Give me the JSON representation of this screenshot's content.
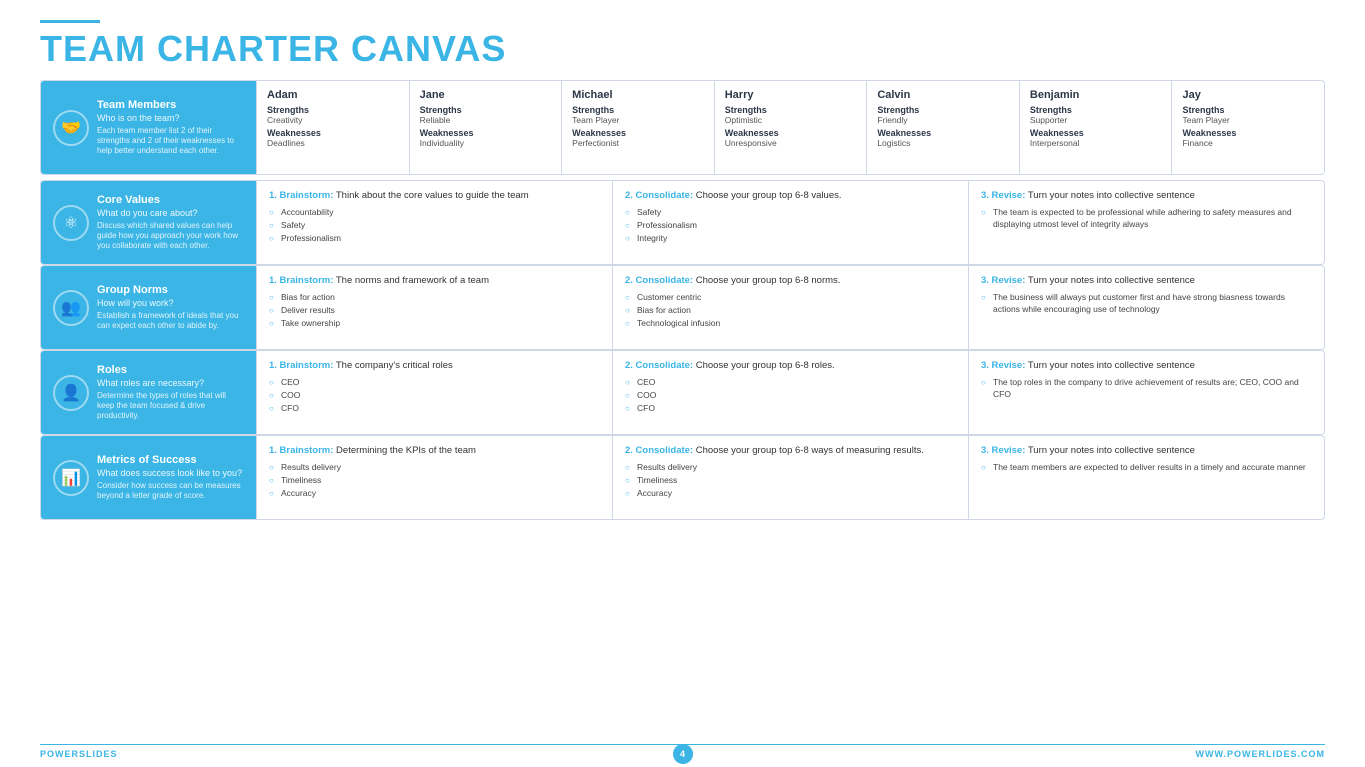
{
  "title": {
    "accent": "",
    "part1": "TEAM CHARTER ",
    "part2": "CANVAS"
  },
  "teamMembers": {
    "label": {
      "title": "Team Members",
      "subtitle": "Who is on the team?",
      "desc": "Each team member list 2 of their strengths and 2 of their weaknesses to help better understand each other."
    },
    "members": [
      {
        "name": "Adam",
        "strengthsLabel": "Strengths",
        "strengthsValue": "Creativity",
        "weaknessesLabel": "Weaknesses",
        "weaknessesValue": "Deadlines"
      },
      {
        "name": "Jane",
        "strengthsLabel": "Strengths",
        "strengthsValue": "Reliable",
        "weaknessesLabel": "Weaknesses",
        "weaknessesValue": "Individuality"
      },
      {
        "name": "Michael",
        "strengthsLabel": "Strengths",
        "strengthsValue": "Team Player",
        "weaknessesLabel": "Weaknesses",
        "weaknessesValue": "Perfectionist"
      },
      {
        "name": "Harry",
        "strengthsLabel": "Strengths",
        "strengthsValue": "Optimistic",
        "weaknessesLabel": "Weaknesses",
        "weaknessesValue": "Unresponsive"
      },
      {
        "name": "Calvin",
        "strengthsLabel": "Strengths",
        "strengthsValue": "Friendly",
        "weaknessesLabel": "Weaknesses",
        "weaknessesValue": "Logistics"
      },
      {
        "name": "Benjamin",
        "strengthsLabel": "Strengths",
        "strengthsValue": "Supporter",
        "weaknessesLabel": "Weaknesses",
        "weaknessesValue": "Interpersonal"
      },
      {
        "name": "Jay",
        "strengthsLabel": "Strengths",
        "strengthsValue": "Team Player",
        "weaknessesLabel": "Weaknesses",
        "weaknessesValue": "Finance"
      }
    ]
  },
  "sections": [
    {
      "label": {
        "title": "Core Values",
        "subtitle": "What do you care about?",
        "desc": "Discuss which shared values can help guide how you approach your work how you collaborate with each other."
      },
      "cells": [
        {
          "titleStrong": "1. Brainstorm:",
          "titleText": " Think about the core values to guide the team",
          "bullets": [
            "Accountability",
            "Safety",
            "Professionalism"
          ]
        },
        {
          "titleStrong": "2. Consolidate:",
          "titleText": " Choose your group top 6-8 values.",
          "bullets": [
            "Safety",
            "Professionalism",
            "Integrity"
          ]
        },
        {
          "titleStrong": "3. Revise:",
          "titleText": " Turn your notes into collective sentence",
          "bullets": [
            "The team is expected to be professional while adhering to safety measures and displaying utmost level of integrity always"
          ]
        }
      ]
    },
    {
      "label": {
        "title": "Group Norms",
        "subtitle": "How will you work?",
        "desc": "Establish a framework of ideals that you can expect each other to abide by."
      },
      "cells": [
        {
          "titleStrong": "1. Brainstorm:",
          "titleText": " The norms and framework of a team",
          "bullets": [
            "Bias for action",
            "Deliver results",
            "Take ownership"
          ]
        },
        {
          "titleStrong": "2. Consolidate:",
          "titleText": " Choose your group top 6-8 norms.",
          "bullets": [
            "Customer centric",
            "Bias for action",
            "Technological infusion"
          ]
        },
        {
          "titleStrong": "3. Revise:",
          "titleText": " Turn your notes into collective sentence",
          "bullets": [
            "The business will always put customer first and have strong biasness towards actions while encouraging use of technology"
          ]
        }
      ]
    },
    {
      "label": {
        "title": "Roles",
        "subtitle": "What roles are necessary?",
        "desc": "Determine the types of roles that will keep the team focused & drive productivity."
      },
      "cells": [
        {
          "titleStrong": "1. Brainstorm:",
          "titleText": " The company's critical roles",
          "bullets": [
            "CEO",
            "COO",
            "CFO"
          ]
        },
        {
          "titleStrong": "2. Consolidate:",
          "titleText": " Choose your group top 6-8 roles.",
          "bullets": [
            "CEO",
            "COO",
            "CFO"
          ]
        },
        {
          "titleStrong": "3. Revise:",
          "titleText": " Turn your notes into collective sentence",
          "bullets": [
            "The top roles in the company to drive achievement of results are; CEO, COO and CFO"
          ]
        }
      ]
    },
    {
      "label": {
        "title": "Metrics of Success",
        "subtitle": "What does success look like to you?",
        "desc": "Consider how success can be measures beyond a letter grade of score."
      },
      "cells": [
        {
          "titleStrong": "1. Brainstorm:",
          "titleText": " Determining the KPIs of the team",
          "bullets": [
            "Results delivery",
            "Timeliness",
            "Accuracy"
          ]
        },
        {
          "titleStrong": "2. Consolidate:",
          "titleText": " Choose your group top 6-8 ways of measuring results.",
          "bullets": [
            "Results delivery",
            "Timeliness",
            "Accuracy"
          ]
        },
        {
          "titleStrong": "3. Revise:",
          "titleText": " Turn your notes into collective sentence",
          "bullets": [
            "The team members are expected to deliver results in a timely and accurate manner"
          ]
        }
      ]
    }
  ],
  "footer": {
    "left": "POWERSLIDES",
    "page": "4",
    "right": "WWW.POWERLIDES.COM"
  },
  "icons": {
    "teamMembers": "🤝",
    "coreValues": "⚛",
    "groupNorms": "👥",
    "roles": "👤",
    "metrics": "📊"
  }
}
